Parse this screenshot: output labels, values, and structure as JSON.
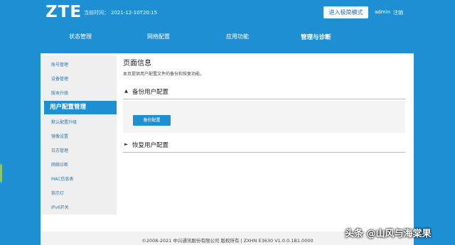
{
  "header": {
    "logo": "ZTE",
    "time_label": "当前时间：",
    "time_value": "2021-12-10T20:15",
    "advanced_mode_button": "进入极简模式",
    "user": "admin",
    "logout": "注销"
  },
  "nav": {
    "items": [
      {
        "label": "状态管理"
      },
      {
        "label": "网络配置"
      },
      {
        "label": "应用功能"
      },
      {
        "label": "管理与诊断"
      }
    ],
    "active_index": 3
  },
  "sidebar": {
    "items": [
      {
        "label": "账号管理"
      },
      {
        "label": "设备管理"
      },
      {
        "label": "版本升级"
      },
      {
        "label": "用户配置管理"
      },
      {
        "label": "默认配置升级"
      },
      {
        "label": "镜像设置"
      },
      {
        "label": "日志管理"
      },
      {
        "label": "网络诊断"
      },
      {
        "label": "MAC信息表"
      },
      {
        "label": "指示灯"
      },
      {
        "label": "IPv6开关"
      }
    ],
    "active_index": 3
  },
  "content": {
    "title": "页面信息",
    "description": "本页提供用户配置文件的备份和恢复功能。",
    "backup_section": {
      "arrow": "▲",
      "label": "备份用户配置",
      "button": "备份配置"
    },
    "restore_section": {
      "arrow": "►",
      "label": "恢复用户配置"
    }
  },
  "footer": {
    "text": "©2008-2021 中兴通讯股份有限公司 版权所有  |  ZXHN E3630 V1.0.0.1B1.0000"
  },
  "watermark": "头条 @山风与海棠果",
  "colors": {
    "brand_blue": "#1f8fd4",
    "panel_bg": "#ffffff",
    "sidebar_bg": "#efefef"
  }
}
